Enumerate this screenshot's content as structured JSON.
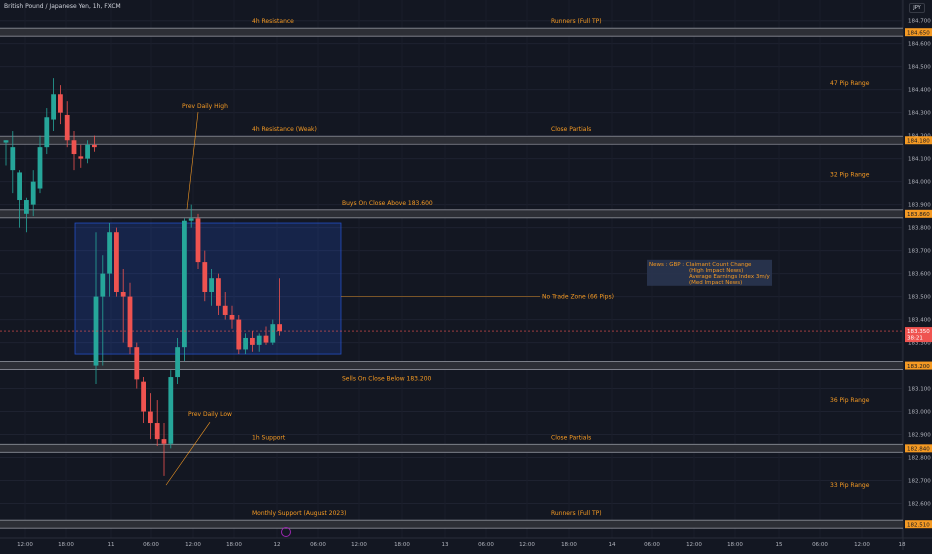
{
  "symbol_title": "British Pound / Japanese Yen, 1h, FXCM",
  "currency_button": "JPY",
  "colors": {
    "background": "#131722",
    "up": "#26a69a",
    "down": "#ef5350",
    "orange": "#f59a23",
    "zone": "#2962ff",
    "news_bg": "#2a3550"
  },
  "chart_data": {
    "type": "candlestick",
    "title": "British Pound / Japanese Yen, 1h, FXCM",
    "ylim": [
      182.45,
      184.79
    ],
    "y_ticks": [
      "184.700",
      "184.600",
      "184.500",
      "184.400",
      "184.300",
      "184.200",
      "184.100",
      "184.000",
      "183.900",
      "183.800",
      "183.700",
      "183.600",
      "183.500",
      "183.400",
      "183.300",
      "183.200",
      "183.100",
      "183.000",
      "182.900",
      "182.800",
      "182.700",
      "182.600"
    ],
    "x_ticks": [
      "12:00",
      "18:00",
      "11",
      "06:00",
      "12:00",
      "18:00",
      "12",
      "06:00",
      "12:00",
      "18:00",
      "13",
      "06:00",
      "12:00",
      "18:00",
      "14",
      "06:00",
      "12:00",
      "18:00",
      "15",
      "06:00",
      "12:00",
      "18"
    ],
    "candles": [
      [
        184.17,
        184.18,
        184.07,
        184.18
      ],
      [
        184.05,
        184.22,
        183.95,
        184.15
      ],
      [
        183.92,
        184.05,
        183.8,
        184.04
      ],
      [
        183.86,
        183.93,
        183.78,
        183.92
      ],
      [
        183.9,
        184.05,
        183.85,
        184.0
      ],
      [
        183.97,
        184.2,
        183.95,
        184.15
      ],
      [
        184.15,
        184.32,
        184.12,
        184.28
      ],
      [
        184.27,
        184.45,
        184.22,
        184.38
      ],
      [
        184.38,
        184.42,
        184.25,
        184.3
      ],
      [
        184.29,
        184.35,
        184.15,
        184.18
      ],
      [
        184.18,
        184.22,
        184.05,
        184.12
      ],
      [
        184.11,
        184.16,
        184.06,
        184.1
      ],
      [
        184.1,
        184.18,
        184.08,
        184.16
      ],
      [
        184.16,
        184.2,
        184.13,
        184.15
      ],
      [
        183.2,
        183.78,
        183.12,
        183.5
      ],
      [
        183.5,
        183.68,
        183.2,
        183.6
      ],
      [
        183.6,
        183.82,
        183.5,
        183.78
      ],
      [
        183.78,
        183.8,
        183.5,
        183.52
      ],
      [
        183.52,
        183.62,
        183.3,
        183.5
      ],
      [
        183.5,
        183.56,
        183.25,
        183.28
      ],
      [
        183.28,
        183.3,
        183.1,
        183.14
      ],
      [
        183.13,
        183.15,
        182.95,
        183.0
      ],
      [
        183.0,
        183.08,
        182.88,
        182.95
      ],
      [
        182.95,
        183.05,
        182.85,
        182.88
      ],
      [
        182.88,
        182.95,
        182.72,
        182.86
      ],
      [
        182.86,
        183.18,
        182.84,
        183.15
      ],
      [
        183.15,
        183.32,
        183.12,
        183.28
      ],
      [
        183.28,
        183.84,
        183.22,
        183.83
      ],
      [
        183.83,
        183.9,
        183.8,
        183.84
      ],
      [
        183.84,
        183.86,
        183.62,
        183.65
      ],
      [
        183.65,
        183.7,
        183.48,
        183.52
      ],
      [
        183.52,
        183.62,
        183.46,
        183.58
      ],
      [
        183.58,
        183.6,
        183.42,
        183.46
      ],
      [
        183.46,
        183.52,
        183.4,
        183.42
      ],
      [
        183.42,
        183.46,
        183.36,
        183.4
      ],
      [
        183.4,
        183.42,
        183.25,
        183.27
      ],
      [
        183.27,
        183.34,
        183.25,
        183.32
      ],
      [
        183.32,
        183.35,
        183.26,
        183.29
      ],
      [
        183.29,
        183.34,
        183.26,
        183.33
      ],
      [
        183.33,
        183.37,
        183.29,
        183.3
      ],
      [
        183.3,
        183.4,
        183.29,
        183.38
      ],
      [
        183.38,
        183.58,
        183.33,
        183.35
      ]
    ],
    "levels": [
      {
        "price": 184.65,
        "label": "184.650",
        "left_text": "4h Resistance",
        "right_text": "Runners (Full TP)"
      },
      {
        "price": 184.18,
        "label": "184.180",
        "left_text": "4h Resistance (Weak)",
        "right_text": "Close Partials"
      },
      {
        "price": 183.86,
        "label": "183.860",
        "left_text": "",
        "right_text": "Buys On Close Above 183.600"
      },
      {
        "price": 183.2,
        "label": "183.200",
        "left_text": "",
        "right_text": "Sells On Close Below 183.200"
      },
      {
        "price": 182.84,
        "label": "182.840",
        "left_text": "1h Support",
        "right_text": "Close Partials"
      },
      {
        "price": 182.51,
        "label": "182.510",
        "left_text": "Monthly Support (August 2023)",
        "right_text": "Runners (Full TP)"
      }
    ],
    "current_price": {
      "label": "183.350",
      "countdown": "38:21",
      "price": 183.35
    },
    "zone": {
      "top": 183.82,
      "bottom": 183.25,
      "label": "No Trade Zone (66 Pips)"
    },
    "range_labels": [
      {
        "price": 184.43,
        "text": "47 Pip Range"
      },
      {
        "price": 184.03,
        "text": "32 Pip Range"
      },
      {
        "price": 183.05,
        "text": "36 Pip Range"
      },
      {
        "price": 182.68,
        "text": "33 Pip Range"
      }
    ],
    "annotations": [
      {
        "text": "Prev Daily High",
        "price": 184.32
      },
      {
        "text": "Prev Daily Low",
        "price": 182.98
      }
    ],
    "news": {
      "line1": "News : GBP : Claimant Count Change",
      "line2": "(High Impact News)",
      "line3": "Average Earnings Index 3m/y",
      "line4": "(Med Impact News)"
    }
  }
}
